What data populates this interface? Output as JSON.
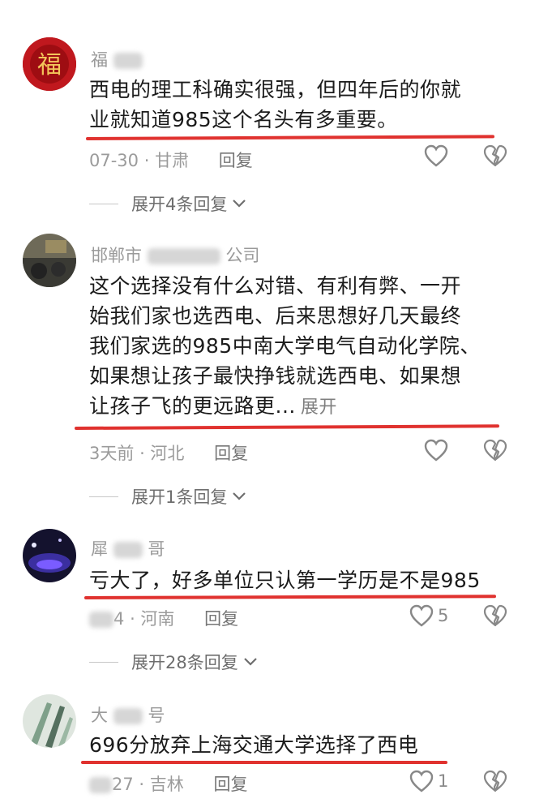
{
  "comments": [
    {
      "username": "福",
      "text_lines": [
        "西电的理工科确实很强，但四年后的你就",
        "业就知道985这个名头有多重要。"
      ],
      "date": "07-30",
      "location": "甘肃",
      "reply_label": "回复",
      "like_count": "",
      "expand_label": "展开4条回复"
    },
    {
      "username_prefix": "邯郸市",
      "username_suffix": "公司",
      "text_lines": [
        "这个选择没有什么对错、有利有弊、一开",
        "始我们家也选西电、后来思想好几天最终",
        "我们家选的985中南大学电气自动化学院、",
        "如果想让孩子最快挣钱就选西电、如果想",
        "让孩子飞的更远路更..."
      ],
      "inline_expand": "展开",
      "date": "3天前",
      "location": "河北",
      "reply_label": "回复",
      "like_count": "",
      "expand_label": "展开1条回复"
    },
    {
      "username_prefix": "犀",
      "username_suffix": "哥",
      "text_lines": [
        "亏大了，好多单位只认第一学历是不是985"
      ],
      "date": "4",
      "location": "河南",
      "reply_label": "回复",
      "like_count": "5",
      "expand_label": "展开28条回复"
    },
    {
      "username_prefix": "大",
      "username_suffix": "号",
      "text_lines": [
        "696分放弃上海交通大学选择了西电"
      ],
      "date": "27",
      "location": "吉林",
      "reply_label": "回复",
      "like_count": "1",
      "expand_label": ""
    }
  ],
  "colors": {
    "underline": "#e0322f",
    "meta": "#9b9b9b"
  },
  "icons": {
    "like": "heart-outline-icon",
    "dislike": "broken-heart-icon",
    "expand": "chevron-down-icon"
  }
}
